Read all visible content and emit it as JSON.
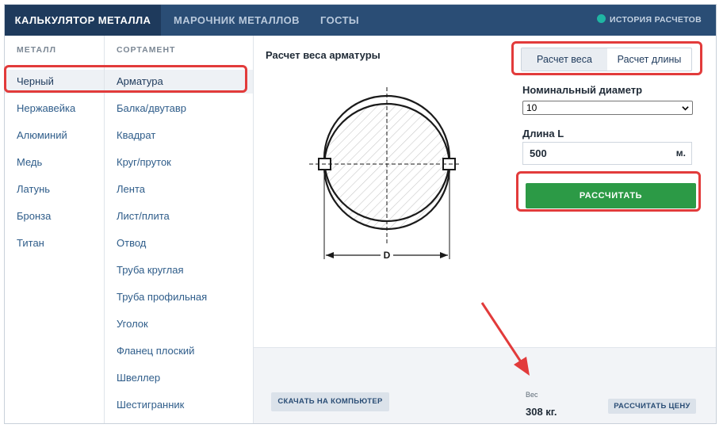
{
  "nav": {
    "tabs": [
      {
        "label": "Калькулятор металла",
        "active": true
      },
      {
        "label": "Марочник металлов",
        "active": false
      },
      {
        "label": "ГОСТы",
        "active": false
      }
    ],
    "history_label": "История расчетов"
  },
  "metal": {
    "header": "МЕТАЛЛ",
    "items": [
      "Черный",
      "Нержавейка",
      "Алюминий",
      "Медь",
      "Латунь",
      "Бронза",
      "Титан"
    ],
    "selected": "Черный"
  },
  "sortament": {
    "header": "СОРТАМЕНТ",
    "items": [
      "Арматура",
      "Балка/двутавр",
      "Квадрат",
      "Круг/пруток",
      "Лента",
      "Лист/плита",
      "Отвод",
      "Труба круглая",
      "Труба профильная",
      "Уголок",
      "Фланец плоский",
      "Швеллер",
      "Шестигранник"
    ],
    "selected": "Арматура"
  },
  "main": {
    "title": "Расчет веса арматуры",
    "drawing_label": "D",
    "modes": [
      "Расчет веса",
      "Расчет длины"
    ],
    "active_mode": "Расчет веса",
    "diameter_label": "Номинальный диаметр",
    "diameter_value": "10",
    "length_label": "Длина L",
    "length_value": "500",
    "length_unit": "м.",
    "calc_button": "Рассчитать"
  },
  "footer": {
    "download_button": "Скачать на компьютер",
    "weight_label": "Вес",
    "weight_value": "308 кг.",
    "price_button": "Рассчитать цену"
  },
  "colors": {
    "nav_bg": "#2a4d75",
    "accent_green": "#2c9a46",
    "highlight_red": "#e23b3b"
  }
}
